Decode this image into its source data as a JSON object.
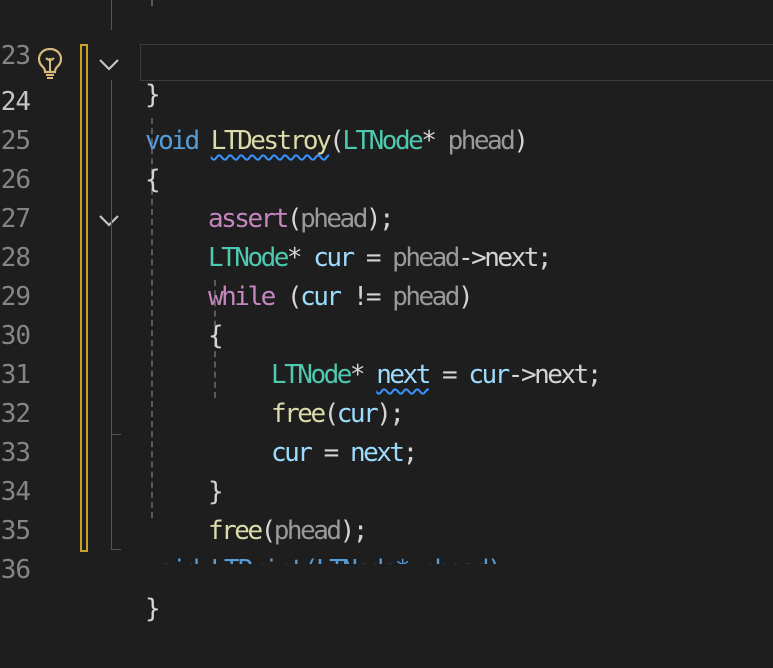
{
  "editor": {
    "current_line": "24",
    "lines": [
      {
        "num": "23"
      },
      {
        "num": "24",
        "t1": "void",
        "t2": " ",
        "t3": "LTDestroy",
        "t4": "(",
        "t5": "LTNode",
        "t6": "* ",
        "t7": "phead",
        "t8": ")"
      },
      {
        "num": "25",
        "t1": "{"
      },
      {
        "num": "26",
        "t1": "assert",
        "t2": "(",
        "t3": "phead",
        "t4": ");"
      },
      {
        "num": "27",
        "t1": "LTNode",
        "t2": "* ",
        "t3": "cur",
        "t4": " = ",
        "t5": "phead",
        "t6": "->",
        "t7": "next",
        "t8": ";"
      },
      {
        "num": "28",
        "t1": "while",
        "t2": " (",
        "t3": "cur",
        "t4": " != ",
        "t5": "phead",
        "t6": ")"
      },
      {
        "num": "29",
        "t1": "{"
      },
      {
        "num": "30",
        "t1": "LTNode",
        "t2": "* ",
        "t3": "next",
        "t4": " = ",
        "t5": "cur",
        "t6": "->",
        "t7": "next",
        "t8": ";"
      },
      {
        "num": "31",
        "t1": "free",
        "t2": "(",
        "t3": "cur",
        "t4": ");"
      },
      {
        "num": "32",
        "t1": "cur",
        "t2": " = ",
        "t3": "next",
        "t4": ";"
      },
      {
        "num": "33",
        "t1": "}"
      },
      {
        "num": "34",
        "t1": "free",
        "t2": "(",
        "t3": "phead",
        "t4": ");"
      },
      {
        "num": "35"
      },
      {
        "num": "36",
        "t1": "}"
      }
    ],
    "top_brace": "}",
    "bottom_partial": "void LTPrint(LTNode* phead)"
  },
  "colors": {
    "background": "#1e1e1e",
    "keyword": "#569cd6",
    "control_keyword": "#c586c0",
    "function": "#dcdcaa",
    "type": "#4ec9b0",
    "variable": "#9cdcfe",
    "parameter": "#9a9a9a",
    "change_marker": "#c9a227",
    "squiggle": "#3794ff"
  },
  "icons": {
    "lightbulb": "lightbulb-icon",
    "fold": "chevron-down-icon"
  }
}
